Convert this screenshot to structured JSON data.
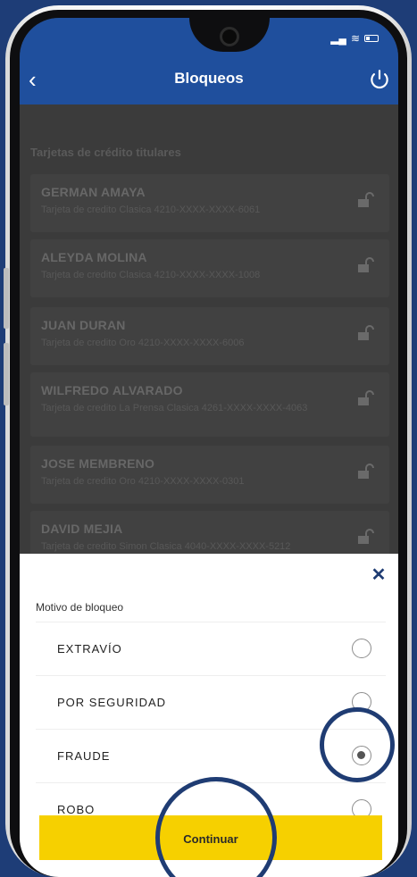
{
  "header": {
    "title": "Bloqueos",
    "back_icon": "chevron-left-icon",
    "power_icon": "power-icon"
  },
  "section_title": "Tarjetas de crédito titulares",
  "cards": [
    {
      "name": "GERMAN AMAYA",
      "desc": "Tarjeta de credito Clasica 4210-XXXX-XXXX-6061"
    },
    {
      "name": "ALEYDA MOLINA",
      "desc": "Tarjeta de credito Clasica 4210-XXXX-XXXX-1008"
    },
    {
      "name": "JUAN DURAN",
      "desc": "Tarjeta de credito Oro 4210-XXXX-XXXX-6006"
    },
    {
      "name": "WILFREDO ALVARADO",
      "desc": "Tarjeta de credito La Prensa Clasica 4261-XXXX-XXXX-4063"
    },
    {
      "name": "JOSE MEMBRENO",
      "desc": "Tarjeta de credito Oro 4210-XXXX-XXXX-0301"
    },
    {
      "name": "DAVID MEJIA",
      "desc": "Tarjeta de credito Simon Clasica 4040-XXXX-XXXX-5212"
    }
  ],
  "sheet": {
    "label": "Motivo de bloqueo",
    "options": [
      {
        "label": "EXTRAVÍO",
        "selected": false
      },
      {
        "label": "POR SEGURIDAD",
        "selected": false
      },
      {
        "label": "FRAUDE",
        "selected": true
      },
      {
        "label": "ROBO",
        "selected": false
      }
    ],
    "continue_label": "Continuar"
  },
  "colors": {
    "app_bar": "#1f4f9d",
    "cta": "#f6d000",
    "highlight": "#1f3c73"
  }
}
